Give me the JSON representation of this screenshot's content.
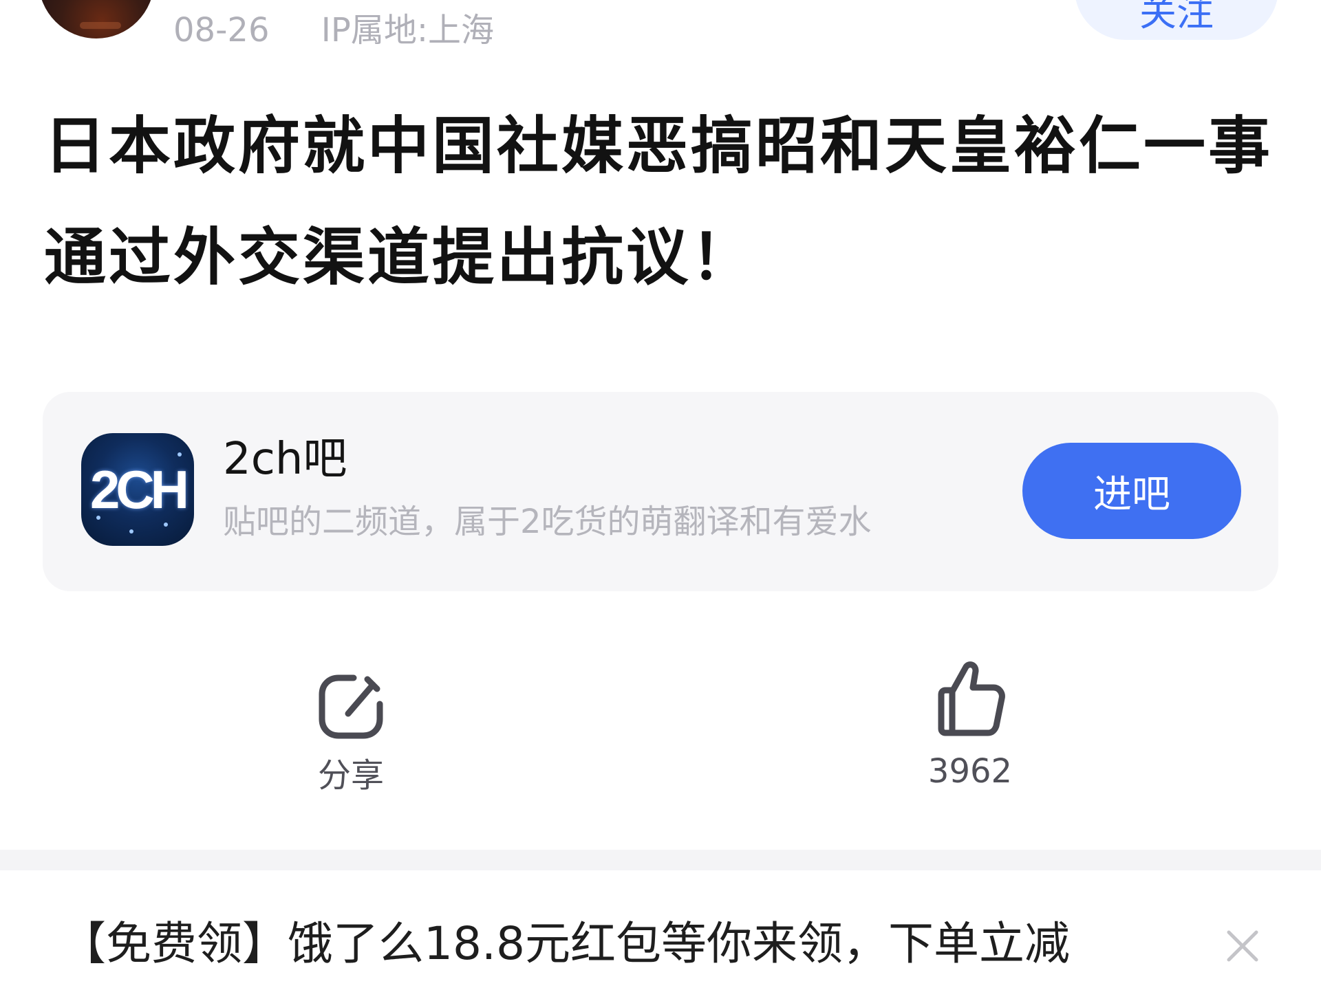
{
  "post": {
    "date": "08-26",
    "ip_location": "IP属地:上海",
    "follow_label": "关注",
    "title": "日本政府就中国社媒恶搞昭和天皇裕仁一事通过外交渠道提出抗议！"
  },
  "forum": {
    "icon_text": "2CH",
    "name": "2ch吧",
    "description": "贴吧的二频道，属于2吃货的萌翻译和有爱水",
    "enter_label": "进吧"
  },
  "actions": {
    "share_label": "分享",
    "like_count": "3962",
    "share_icon": "share-icon",
    "like_icon": "thumbs-up-icon"
  },
  "ad": {
    "text": "【免费领】饿了么18.8元红包等你来领，下单立减",
    "close_icon": "close-icon"
  },
  "colors": {
    "accent": "#3f70f2",
    "follow_text": "#3b6ff5",
    "follow_bg": "#eef3ff",
    "card_bg": "#f6f6f8",
    "muted_text": "#b0b0b8"
  }
}
